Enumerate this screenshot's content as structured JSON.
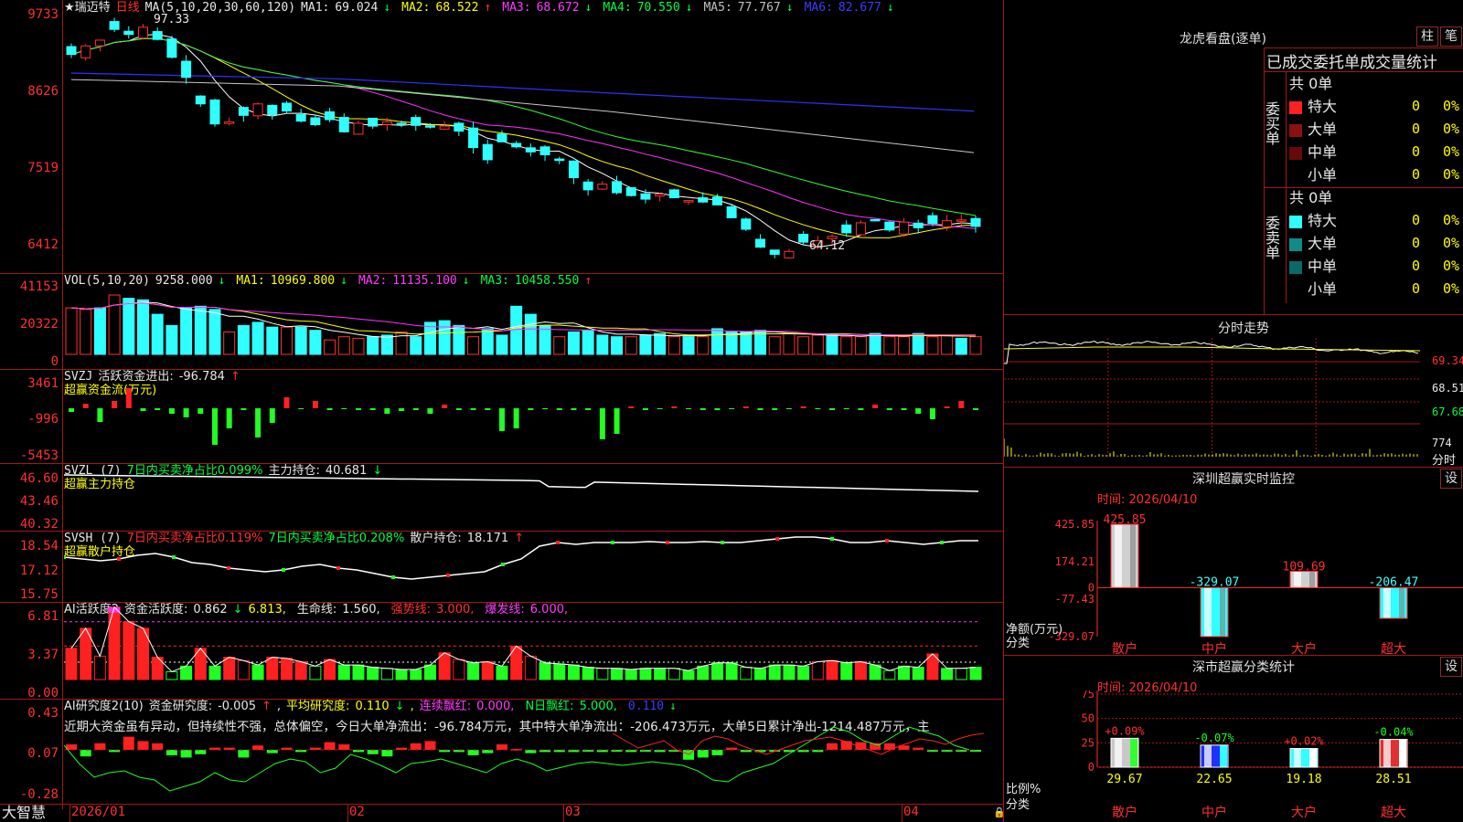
{
  "stock": {
    "name": "★瑞迈特",
    "period": "日线"
  },
  "main": {
    "ma_params": "MA(5,10,20,30,60,120)",
    "ma1_label": "MA1:",
    "ma1": "69.024",
    "ma2_label": "MA2:",
    "ma2": "68.522",
    "ma3_label": "MA3:",
    "ma3": "68.672",
    "ma4_label": "MA4:",
    "ma4": "70.550",
    "ma5_label": "MA5:",
    "ma5": "77.767",
    "ma6_label": "MA6:",
    "ma6": "82.677",
    "high_label": "97.33",
    "low_label": "64.12",
    "y_ticks": [
      "9733",
      "8626",
      "7519",
      "6412"
    ]
  },
  "vol": {
    "params": "VOL(5,10,20)",
    "value": "9258.000",
    "ma1_label": "MA1:",
    "ma1": "10969.800",
    "ma2_label": "MA2:",
    "ma2": "11135.100",
    "ma3_label": "MA3:",
    "ma3": "10458.550",
    "y_ticks": [
      "41153",
      "20322",
      "0"
    ]
  },
  "svzj": {
    "name": "SVZJ",
    "label": "活跃资金进出:",
    "value": "-96.784",
    "sub": "超赢资金流(万元)",
    "y_ticks": [
      "3461",
      "-996",
      "-5453"
    ]
  },
  "svzl": {
    "name": "SVZL (7)",
    "label1": "7日内买卖净占比0.099%",
    "label2": "主力持仓:",
    "value": "40.681",
    "sub": "超赢主力持仓",
    "y_ticks": [
      "46.60",
      "43.46",
      "40.32"
    ]
  },
  "svsh": {
    "name": "SVSH (7)",
    "label1": "7日内买卖净占比0.119%",
    "label2": "7日内买卖净占比0.208%",
    "label3": "散户持仓:",
    "value": "18.171",
    "sub": "超赢散户持仓",
    "y_ticks": [
      "18.54",
      "17.12",
      "15.75"
    ]
  },
  "ai1": {
    "name": "AI活跃度2",
    "l1": "资金活跃度:",
    "v1": "0.862",
    "v2": "6.813,",
    "l3": "生命线:",
    "v3": "1.560,",
    "l4": "强势线:",
    "v4": "3.000,",
    "l5": "爆发线:",
    "v5": "6.000,",
    "y_ticks": [
      "6.81",
      "3.37",
      "0.00"
    ]
  },
  "ai2": {
    "name": "AI研究度2(10)",
    "l1": "资金研究度:",
    "v1": "-0.005",
    "l2": "平均研究度:",
    "v2": "0.110",
    "l3": "连续飘红:",
    "v3": "0.000,",
    "l4": "N日飘红:",
    "v4": "5.000,",
    "v5": "0.110",
    "summary": "近期大资金虽有异动，但持续性不强，总体偏空，今日大单净流出：-96.784万元，其中特大单净流出：-206.473万元，大单5日累计净出-1214.487万元，主",
    "y_ticks": [
      "0.43",
      "0.07",
      "-0.28"
    ]
  },
  "xaxis": {
    "labels": [
      "2026/01",
      "02",
      "03",
      "04"
    ],
    "brand": "大智慧"
  },
  "dragon": {
    "title": "龙虎看盘(逐单)",
    "btn_bar": "柱",
    "btn_stroke": "笔",
    "tabs": "已成交委托单成交量统计",
    "buy": {
      "side": "委买单",
      "total": "共 0单",
      "rows": [
        {
          "name": "特大",
          "cnt": "0",
          "pct": "0%",
          "color": "#ff2020"
        },
        {
          "name": "大单",
          "cnt": "0",
          "pct": "0%",
          "color": "#8b1010"
        },
        {
          "name": "中单",
          "cnt": "0",
          "pct": "0%",
          "color": "#6a0808"
        },
        {
          "name": "小单",
          "cnt": "0",
          "pct": "0%",
          "color": "#000000"
        }
      ]
    },
    "sell": {
      "side": "委卖单",
      "total": "共 0单",
      "rows": [
        {
          "name": "特大",
          "cnt": "0",
          "pct": "0%",
          "color": "#30ffff"
        },
        {
          "name": "大单",
          "cnt": "0",
          "pct": "0%",
          "color": "#108a8a"
        },
        {
          "name": "中单",
          "cnt": "0",
          "pct": "0%",
          "color": "#0a6a6a"
        },
        {
          "name": "小单",
          "cnt": "0",
          "pct": "0%",
          "color": "#000000"
        }
      ]
    }
  },
  "intraday": {
    "title": "分时走势",
    "y_ticks": [
      "69.34",
      "68.51",
      "67.68"
    ],
    "vol_tick": "774",
    "vol_label": "分时"
  },
  "monitor": {
    "title": "深圳超赢实时监控",
    "btn": "设",
    "date": "时间: 2026/04/10",
    "y_ticks": [
      "425.85",
      "174.21",
      "0",
      "-77.43",
      "-329.07"
    ],
    "ylabel1": "净额(万元)",
    "ylabel2": "分类",
    "chart_data": {
      "type": "bar",
      "categories": [
        "散户",
        "中户",
        "大户",
        "超大"
      ],
      "values": [
        425.85,
        -329.07,
        109.69,
        -206.47
      ],
      "value_labels": [
        "425.85",
        "-329.07",
        "109.69",
        "-206.47"
      ],
      "ylim": [
        -329.07,
        425.85
      ],
      "colors": [
        "#d0d0d0",
        "#30ffff",
        "#d0d0d0",
        "#30ffff"
      ]
    }
  },
  "classify": {
    "title": "深市超赢分类统计",
    "btn": "设",
    "date": "时间: 2026/04/10",
    "y_ticks": [
      "75",
      "50",
      "25",
      "0"
    ],
    "ylabel1": "比例%",
    "ylabel2": "分类",
    "chart_data": {
      "type": "bar",
      "categories": [
        "散户",
        "中户",
        "大户",
        "超大"
      ],
      "values": [
        29.67,
        22.65,
        19.18,
        28.51
      ],
      "value_labels": [
        "29.67",
        "22.65",
        "19.18",
        "28.51"
      ],
      "change_labels": [
        "+0.09%",
        "-0.07%",
        "+0.02%",
        "-0.04%"
      ],
      "ylim": [
        0,
        75
      ],
      "colors": [
        "#c8c8c8",
        "#2030ff",
        "#30ffff",
        "#e03030"
      ],
      "accent": [
        "#30ff30",
        "#30ffff",
        "#ffffff",
        "#ffffff"
      ]
    }
  }
}
